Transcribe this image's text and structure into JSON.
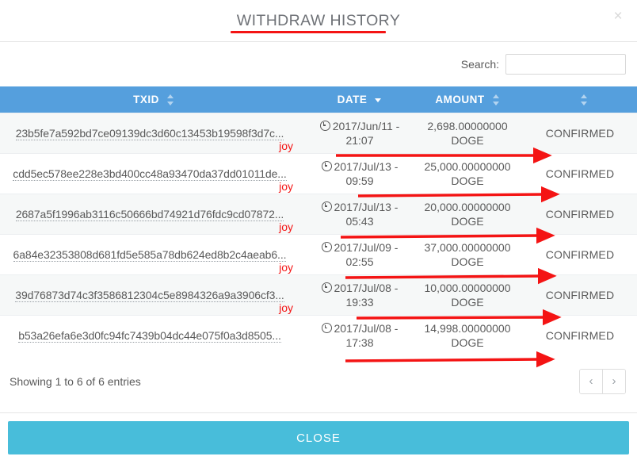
{
  "modal": {
    "title": "WITHDRAW HISTORY",
    "close_icon_label": "×",
    "footer_button_label": "CLOSE"
  },
  "search": {
    "label": "Search:",
    "value": "",
    "placeholder": ""
  },
  "table": {
    "columns": [
      {
        "key": "txid",
        "label": "TXID",
        "sort": "none"
      },
      {
        "key": "date",
        "label": "DATE",
        "sort": "desc"
      },
      {
        "key": "amount",
        "label": "AMOUNT",
        "sort": "none"
      },
      {
        "key": "status",
        "label": "",
        "sort": "none"
      }
    ],
    "rows": [
      {
        "txid": "23b5fe7a592bd7ce09139dc3d60c13453b19598f3d7c...",
        "date_line1": "2017/Jun/11 -",
        "date_line2": "21:07",
        "amount_line1": "2,698.00000000",
        "amount_line2": "DOGE",
        "status": "CONFIRMED",
        "annotation": "joy"
      },
      {
        "txid": "cdd5ec578ee228e3bd400cc48a93470da37dd01011de...",
        "date_line1": "2017/Jul/13 -",
        "date_line2": "09:59",
        "amount_line1": "25,000.00000000",
        "amount_line2": "DOGE",
        "status": "CONFIRMED",
        "annotation": "joy"
      },
      {
        "txid": "2687a5f1996ab3116c50666bd74921d76fdc9cd07872...",
        "date_line1": "2017/Jul/13 -",
        "date_line2": "05:43",
        "amount_line1": "20,000.00000000",
        "amount_line2": "DOGE",
        "status": "CONFIRMED",
        "annotation": "joy"
      },
      {
        "txid": "6a84e32353808d681fd5e585a78db624ed8b2c4aeab6...",
        "date_line1": "2017/Jul/09 -",
        "date_line2": "02:55",
        "amount_line1": "37,000.00000000",
        "amount_line2": "DOGE",
        "status": "CONFIRMED",
        "annotation": "joy"
      },
      {
        "txid": "39d76873d74c3f3586812304c5e8984326a9a3906cf3...",
        "date_line1": "2017/Jul/08 -",
        "date_line2": "19:33",
        "amount_line1": "10,000.00000000",
        "amount_line2": "DOGE",
        "status": "CONFIRMED",
        "annotation": "joy"
      },
      {
        "txid": "b53a26efa6e3d0fc94fc7439b04dc44e075f0a3d8505...",
        "date_line1": "2017/Jul/08 -",
        "date_line2": "17:38",
        "amount_line1": "14,998.00000000",
        "amount_line2": "DOGE",
        "status": "CONFIRMED",
        "annotation": ""
      }
    ]
  },
  "footer": {
    "entries_info": "Showing 1 to 6 of 6 entries",
    "prev_label": "‹",
    "next_label": "›"
  },
  "colors": {
    "table_header_blue": "#559fdd",
    "close_button_cyan": "#48bdda",
    "status_green": "#7f9c3f",
    "annotation_red": "#f41414",
    "row_stripe": "#f6f8f8"
  }
}
